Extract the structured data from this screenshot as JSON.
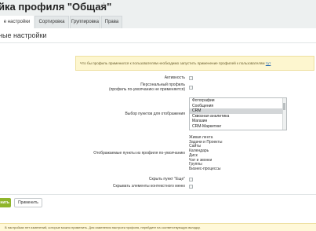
{
  "page": {
    "title": "йка профиля \"Общая\"",
    "star_glyph": "☆"
  },
  "tabs": [
    {
      "label": "е настройки",
      "active": true
    },
    {
      "label": "Сортировка",
      "active": false
    },
    {
      "label": "Группировка",
      "active": false
    },
    {
      "label": "Права",
      "active": false
    }
  ],
  "section": {
    "title": "ные настройки"
  },
  "notice": {
    "text": "Что бы профиль применился к пользователям необходимо запустить применение профилей к пользователям ",
    "link": "тут"
  },
  "fields": {
    "active_label": "Активность",
    "personal_label_1": "Персональный профиль",
    "personal_label_2": "(профиль по-умолчанию не применяется)",
    "menu_select_label": "Выбор пунктов для отображения",
    "menu_options": [
      "Фотографии",
      "Сообщения",
      "CRM",
      "Сквозная аналитика",
      "Магазин",
      "CRM-Маркетинг"
    ],
    "menu_selected": "CRM",
    "default_items_label": "Отображаемые пункты из профиля по-умолчанию",
    "default_items": [
      "Живая лента",
      "Задачи и Проекты",
      "Сайты",
      "Календарь",
      "Диск",
      "Чат и звонки",
      "Группы",
      "Бизнес-процессы"
    ],
    "hide_more_label": "Скрыть пункт \"Еще\"",
    "hide_context_label": "Скрывать элементы контекстного меню"
  },
  "buttons": {
    "save": "нить",
    "apply": "Применить"
  },
  "footer": {
    "text": "В настройках нет изменений, которые можно применить. Для изменения настроек профиля, перейдите на соответствующую вкладку."
  }
}
